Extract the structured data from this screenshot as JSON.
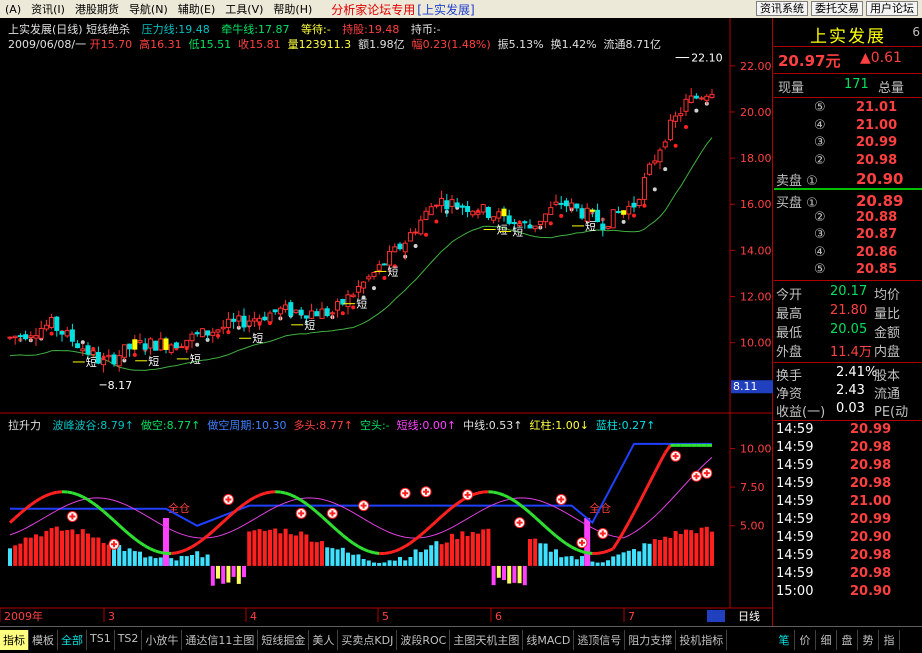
{
  "menubar": {
    "items": [
      "(A)",
      "资讯(I)",
      "港股期货",
      "导航(N)",
      "辅助(E)",
      "工具(V)",
      "帮助(H)"
    ],
    "center_title": "分析家论坛专用",
    "center_sub": "[上实发展]",
    "right_buttons": [
      "资讯系统",
      "委托交易",
      "用户论坛"
    ]
  },
  "chart_header": {
    "name": "上实发展(日线)",
    "indicator": "短线绝杀",
    "lines": [
      {
        "label": "压力线:19.48",
        "color": "#00c0c0"
      },
      {
        "label": "牵牛线:17.87",
        "color": "#00e060"
      },
      {
        "label": "等待:-",
        "color": "#ffff40"
      },
      {
        "label": "持股:19.48",
        "color": "#ff4040"
      },
      {
        "label": "持币:-",
        "color": "#e0e0e0"
      }
    ],
    "date": "2009/06/08/一",
    "ohlc": [
      {
        "label": "开15.70",
        "color": "#ff4040"
      },
      {
        "label": "高16.31",
        "color": "#ff4040"
      },
      {
        "label": "低15.51",
        "color": "#00e060"
      },
      {
        "label": "收15.81",
        "color": "#ff4040"
      },
      {
        "label": "量123911.3",
        "color": "#ffff40"
      },
      {
        "label": "额1.98亿",
        "color": "#e0e0e0"
      },
      {
        "label": "幅0.23(1.48%)",
        "color": "#ff4040"
      },
      {
        "label": "振5.13%",
        "color": "#e0e0e0"
      },
      {
        "label": "换1.42%",
        "color": "#e0e0e0"
      },
      {
        "label": "流通8.71亿",
        "color": "#e0e0e0"
      }
    ]
  },
  "sub_header": {
    "name": "拉升力",
    "lines": [
      {
        "label": "波峰波谷:8.79↑",
        "color": "#00c0c0"
      },
      {
        "label": "做空:8.77↑",
        "color": "#00e060"
      },
      {
        "label": "做空周期:10.30",
        "color": "#4080ff"
      },
      {
        "label": "多头:8.77↑",
        "color": "#ff4040"
      },
      {
        "label": "空头:-",
        "color": "#00e060"
      },
      {
        "label": "短线:0.00↑",
        "color": "#ff40ff"
      },
      {
        "label": "中线:0.53↑",
        "color": "#e0e0e0"
      },
      {
        "label": "红柱:1.00↓",
        "color": "#ffff40"
      },
      {
        "label": "蓝柱:0.27↑",
        "color": "#00e0e0"
      }
    ]
  },
  "price_axis": [
    "22.00",
    "20.00",
    "18.00",
    "16.00",
    "14.00",
    "12.00",
    "10.00",
    "8.00"
  ],
  "price_marker": "8.11",
  "sub_axis": [
    "10.00",
    "7.50",
    "5.00"
  ],
  "annotations": {
    "high": "22.10",
    "low": "8.17",
    "signal": "短",
    "cang": "全仓"
  },
  "x_labels": [
    "2009年",
    "3",
    "4",
    "5",
    "6",
    "7"
  ],
  "period": "日线",
  "panel": {
    "stock_name": "上实发展",
    "tab_num": "6",
    "price": "20.97元",
    "change": "▲0.61",
    "volume_now_label": "现量",
    "volume_now": "171",
    "total_label": "总量",
    "sell": [
      {
        "no": "⑤",
        "price": "21.01"
      },
      {
        "no": "④",
        "price": "21.00"
      },
      {
        "no": "③",
        "price": "20.99"
      },
      {
        "no": "②",
        "price": "20.98"
      },
      {
        "no": "卖盘 ①",
        "price": "20.90"
      }
    ],
    "buy": [
      {
        "no": "买盘 ①",
        "price": "20.89"
      },
      {
        "no": "②",
        "price": "20.88"
      },
      {
        "no": "③",
        "price": "20.87"
      },
      {
        "no": "④",
        "price": "20.86"
      },
      {
        "no": "⑤",
        "price": "20.85"
      }
    ],
    "stats": [
      {
        "l1": "今开",
        "v1": "20.17",
        "c1": "#00e060",
        "l2": "均价"
      },
      {
        "l1": "最高",
        "v1": "21.80",
        "c1": "#ff4040",
        "l2": "量比"
      },
      {
        "l1": "最低",
        "v1": "20.05",
        "c1": "#00e060",
        "l2": "金额"
      },
      {
        "l1": "外盘",
        "v1": "11.4万",
        "c1": "#ff4040",
        "l2": "内盘"
      }
    ],
    "stats2": [
      {
        "l1": "换手",
        "v1": "2.41%",
        "l2": "股本"
      },
      {
        "l1": "净资",
        "v1": "2.43",
        "l2": "流通"
      },
      {
        "l1": "收益(一)",
        "v1": "0.03",
        "l2": "PE(动"
      }
    ],
    "ticks": [
      {
        "time": "14:59",
        "price": "20.99"
      },
      {
        "time": "14:59",
        "price": "20.98"
      },
      {
        "time": "14:59",
        "price": "20.98"
      },
      {
        "time": "14:59",
        "price": "20.98"
      },
      {
        "time": "14:59",
        "price": "21.00"
      },
      {
        "time": "14:59",
        "price": "20.99"
      },
      {
        "time": "14:59",
        "price": "20.90"
      },
      {
        "time": "14:59",
        "price": "20.98"
      },
      {
        "time": "14:59",
        "price": "20.98"
      },
      {
        "time": "15:00",
        "price": "20.90"
      }
    ]
  },
  "bottom_tabs": [
    "指标",
    "模板",
    "全部",
    "TS1",
    "TS2",
    "小放牛",
    "通达信11主图",
    "短线掘金",
    "美人",
    "买卖点KDJ",
    "波段ROC",
    "主图天机主图",
    "线MACD",
    "逃顶信号",
    "阻力支撑",
    "投机指标"
  ],
  "right_tabs": [
    "笔",
    "价",
    "细",
    "盘",
    "势",
    "指"
  ],
  "chart_data": {
    "type": "candlestick",
    "ylim": [
      7.6,
      22.6
    ],
    "x_range": [
      "2009年",
      "7"
    ],
    "high": 22.1,
    "low": 8.17,
    "close_last": 20.97,
    "sub_ylim": [
      0,
      11
    ]
  }
}
